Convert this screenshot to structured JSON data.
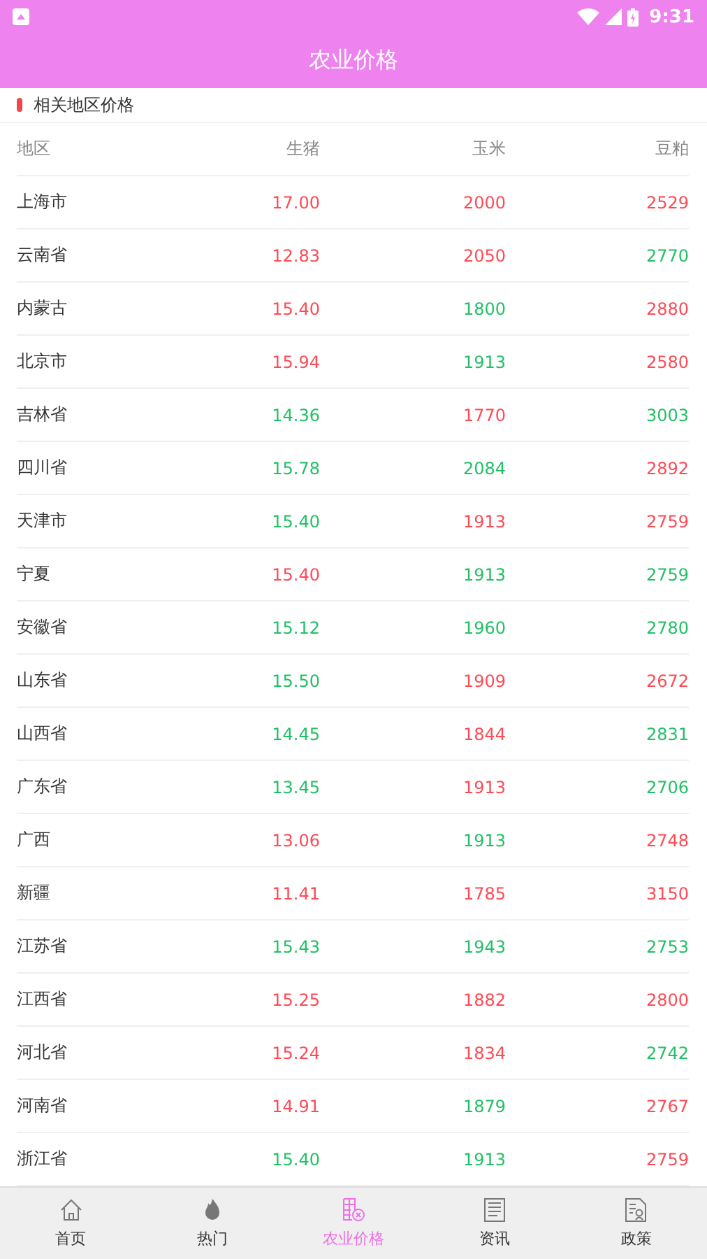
{
  "status_bar": {
    "time": "9:31"
  },
  "title": "农业价格",
  "section": {
    "title": "相关地区价格"
  },
  "table": {
    "columns": [
      "地区",
      "生猪",
      "玉米",
      "豆粕"
    ],
    "rows": [
      {
        "cells": [
          {
            "kind": "label",
            "value": "上海市"
          },
          {
            "kind": "price",
            "value": "17.00",
            "up": true
          },
          {
            "kind": "price",
            "value": "2000",
            "up": true
          },
          {
            "kind": "price",
            "value": "2529",
            "up": true
          }
        ]
      },
      {
        "cells": [
          {
            "kind": "label",
            "value": "云南省"
          },
          {
            "kind": "price",
            "value": "12.83",
            "up": true
          },
          {
            "kind": "price",
            "value": "2050",
            "up": true
          },
          {
            "kind": "price",
            "value": "2770",
            "up": false
          }
        ]
      },
      {
        "cells": [
          {
            "kind": "label",
            "value": "内蒙古"
          },
          {
            "kind": "price",
            "value": "15.40",
            "up": true
          },
          {
            "kind": "price",
            "value": "1800",
            "up": false
          },
          {
            "kind": "price",
            "value": "2880",
            "up": true
          }
        ]
      },
      {
        "cells": [
          {
            "kind": "label",
            "value": "北京市"
          },
          {
            "kind": "price",
            "value": "15.94",
            "up": true
          },
          {
            "kind": "price",
            "value": "1913",
            "up": false
          },
          {
            "kind": "price",
            "value": "2580",
            "up": true
          }
        ]
      },
      {
        "cells": [
          {
            "kind": "label",
            "value": "吉林省"
          },
          {
            "kind": "price",
            "value": "14.36",
            "up": false
          },
          {
            "kind": "price",
            "value": "1770",
            "up": true
          },
          {
            "kind": "price",
            "value": "3003",
            "up": false
          }
        ]
      },
      {
        "cells": [
          {
            "kind": "label",
            "value": "四川省"
          },
          {
            "kind": "price",
            "value": "15.78",
            "up": false
          },
          {
            "kind": "price",
            "value": "2084",
            "up": false
          },
          {
            "kind": "price",
            "value": "2892",
            "up": true
          }
        ]
      },
      {
        "cells": [
          {
            "kind": "label",
            "value": "天津市"
          },
          {
            "kind": "price",
            "value": "15.40",
            "up": false
          },
          {
            "kind": "price",
            "value": "1913",
            "up": true
          },
          {
            "kind": "price",
            "value": "2759",
            "up": true
          }
        ]
      },
      {
        "cells": [
          {
            "kind": "label",
            "value": "宁夏"
          },
          {
            "kind": "price",
            "value": "15.40",
            "up": true
          },
          {
            "kind": "price",
            "value": "1913",
            "up": false
          },
          {
            "kind": "price",
            "value": "2759",
            "up": false
          }
        ]
      },
      {
        "cells": [
          {
            "kind": "label",
            "value": "安徽省"
          },
          {
            "kind": "price",
            "value": "15.12",
            "up": false
          },
          {
            "kind": "price",
            "value": "1960",
            "up": false
          },
          {
            "kind": "price",
            "value": "2780",
            "up": false
          }
        ]
      },
      {
        "cells": [
          {
            "kind": "label",
            "value": "山东省"
          },
          {
            "kind": "price",
            "value": "15.50",
            "up": false
          },
          {
            "kind": "price",
            "value": "1909",
            "up": true
          },
          {
            "kind": "price",
            "value": "2672",
            "up": true
          }
        ]
      },
      {
        "cells": [
          {
            "kind": "label",
            "value": "山西省"
          },
          {
            "kind": "price",
            "value": "14.45",
            "up": false
          },
          {
            "kind": "price",
            "value": "1844",
            "up": true
          },
          {
            "kind": "price",
            "value": "2831",
            "up": false
          }
        ]
      },
      {
        "cells": [
          {
            "kind": "label",
            "value": "广东省"
          },
          {
            "kind": "price",
            "value": "13.45",
            "up": false
          },
          {
            "kind": "price",
            "value": "1913",
            "up": true
          },
          {
            "kind": "price",
            "value": "2706",
            "up": false
          }
        ]
      },
      {
        "cells": [
          {
            "kind": "label",
            "value": "广西"
          },
          {
            "kind": "price",
            "value": "13.06",
            "up": true
          },
          {
            "kind": "price",
            "value": "1913",
            "up": false
          },
          {
            "kind": "price",
            "value": "2748",
            "up": true
          }
        ]
      },
      {
        "cells": [
          {
            "kind": "label",
            "value": "新疆"
          },
          {
            "kind": "price",
            "value": "11.41",
            "up": true
          },
          {
            "kind": "price",
            "value": "1785",
            "up": true
          },
          {
            "kind": "price",
            "value": "3150",
            "up": true
          }
        ]
      },
      {
        "cells": [
          {
            "kind": "label",
            "value": "江苏省"
          },
          {
            "kind": "price",
            "value": "15.43",
            "up": false
          },
          {
            "kind": "price",
            "value": "1943",
            "up": false
          },
          {
            "kind": "price",
            "value": "2753",
            "up": false
          }
        ]
      },
      {
        "cells": [
          {
            "kind": "label",
            "value": "江西省"
          },
          {
            "kind": "price",
            "value": "15.25",
            "up": true
          },
          {
            "kind": "price",
            "value": "1882",
            "up": true
          },
          {
            "kind": "price",
            "value": "2800",
            "up": true
          }
        ]
      },
      {
        "cells": [
          {
            "kind": "label",
            "value": "河北省"
          },
          {
            "kind": "price",
            "value": "15.24",
            "up": true
          },
          {
            "kind": "price",
            "value": "1834",
            "up": true
          },
          {
            "kind": "price",
            "value": "2742",
            "up": false
          }
        ]
      },
      {
        "cells": [
          {
            "kind": "label",
            "value": "河南省"
          },
          {
            "kind": "price",
            "value": "14.91",
            "up": true
          },
          {
            "kind": "price",
            "value": "1879",
            "up": false
          },
          {
            "kind": "price",
            "value": "2767",
            "up": true
          }
        ]
      },
      {
        "cells": [
          {
            "kind": "label",
            "value": "浙江省"
          },
          {
            "kind": "price",
            "value": "15.40",
            "up": false
          },
          {
            "kind": "price",
            "value": "1913",
            "up": false
          },
          {
            "kind": "price",
            "value": "2759",
            "up": true
          }
        ]
      }
    ]
  },
  "tabs": [
    {
      "label": "首页",
      "kind": "home",
      "selected": false
    },
    {
      "label": "热门",
      "kind": "hot",
      "selected": false
    },
    {
      "label": "农业价格",
      "kind": "price",
      "selected": true
    },
    {
      "label": "资讯",
      "kind": "news",
      "selected": false
    },
    {
      "label": "政策",
      "kind": "policy",
      "selected": false
    }
  ]
}
